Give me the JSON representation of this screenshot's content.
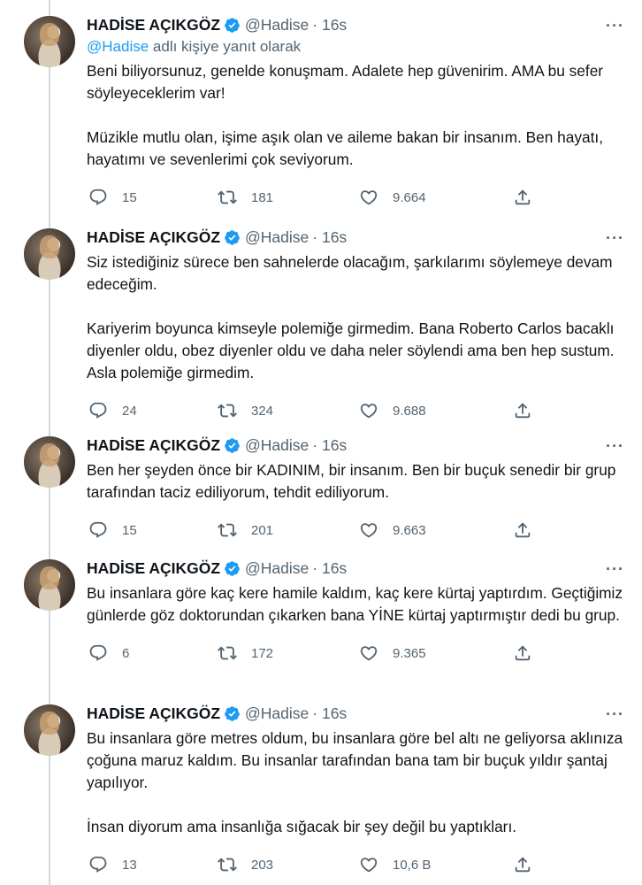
{
  "colors": {
    "accent": "#1d9bf0",
    "muted": "#536471",
    "text": "#0f1419"
  },
  "tweets": [
    {
      "name": "HADİSE AÇIKGÖZ",
      "handle": "@Hadise",
      "time": "· 16s",
      "more": "···",
      "reply_link": "@Hadise",
      "reply_rest": " adlı kişiye yanıt olarak",
      "paragraphs": [
        "Beni biliyorsunuz, genelde konuşmam. Adalete hep güvenirim. AMA bu sefer söyleyeceklerim var!",
        "Müzikle mutlu olan, işime aşık olan ve aileme bakan bir insanım. Ben hayatı, hayatımı ve sevenlerimi çok seviyorum."
      ],
      "replies": "15",
      "retweets": "181",
      "likes": "9.664"
    },
    {
      "name": "HADİSE AÇIKGÖZ",
      "handle": "@Hadise",
      "time": "· 16s",
      "more": "···",
      "paragraphs": [
        "Siz istediğiniz sürece ben sahnelerde olacağım, şarkılarımı söylemeye devam edeceğim.",
        "Kariyerim boyunca kimseyle polemiğe girmedim. Bana Roberto Carlos bacaklı diyenler oldu, obez diyenler oldu ve daha neler söylendi ama ben hep sustum. Asla polemiğe girmedim."
      ],
      "replies": "24",
      "retweets": "324",
      "likes": "9.688"
    },
    {
      "name": "HADİSE AÇIKGÖZ",
      "handle": "@Hadise",
      "time": "· 16s",
      "more": "···",
      "paragraphs": [
        "Ben her şeyden önce bir KADINIM, bir insanım. Ben bir buçuk senedir bir grup tarafından taciz ediliyorum, tehdit ediliyorum."
      ],
      "replies": "15",
      "retweets": "201",
      "likes": "9.663"
    },
    {
      "name": "HADİSE AÇIKGÖZ",
      "handle": "@Hadise",
      "time": "· 16s",
      "more": "···",
      "paragraphs": [
        "Bu insanlara göre kaç kere hamile kaldım, kaç kere kürtaj yaptırdım. Geçtiğimiz günlerde göz doktorundan çıkarken bana YİNE kürtaj yaptırmıştır dedi bu grup."
      ],
      "replies": "6",
      "retweets": "172",
      "likes": "9.365"
    },
    {
      "name": "HADİSE AÇIKGÖZ",
      "handle": "@Hadise",
      "time": "· 16s",
      "more": "···",
      "paragraphs": [
        "Bu insanlara göre metres oldum, bu insanlara göre bel altı ne geliyorsa aklınıza çoğuna maruz kaldım. Bu insanlar tarafından bana tam bir buçuk yıldır şantaj yapılıyor.",
        "İnsan diyorum ama insanlığa sığacak bir şey değil bu yaptıkları."
      ],
      "replies": "13",
      "retweets": "203",
      "likes": "10,6 B"
    }
  ]
}
